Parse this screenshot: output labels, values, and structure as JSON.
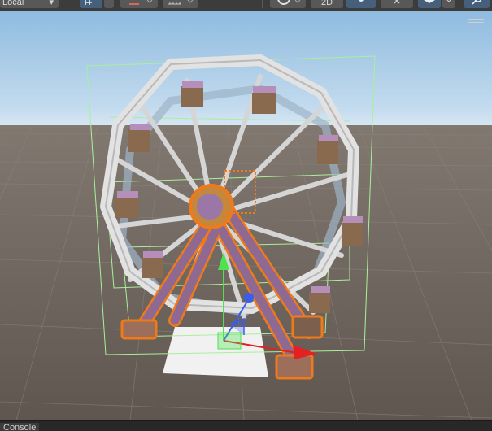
{
  "toolbar": {
    "pivot_rotation_label": "Local",
    "mode_2d_label": "2D",
    "items": [
      {
        "name": "pivot-rotation-dropdown",
        "icon": "chevron-down-icon"
      },
      {
        "name": "grid-snapping-button",
        "icon": "grid-snap-icon"
      },
      {
        "name": "increment-snap-button",
        "icon": "increment-snap-icon"
      },
      {
        "name": "draw-mode-dropdown",
        "icon": "shaded-sphere-icon"
      },
      {
        "name": "lighting-toggle",
        "icon": "lightbulb-icon"
      },
      {
        "name": "audio-toggle",
        "icon": "speaker-mute-icon"
      },
      {
        "name": "effects-dropdown",
        "icon": "layers-icon"
      },
      {
        "name": "search-button",
        "icon": "search-icon"
      }
    ]
  },
  "scene": {
    "menu_icon": "hamburger-icon",
    "colors": {
      "sky_top": "#8fbbe0",
      "sky_horizon": "#d6e6f3",
      "ground": "#6b625a",
      "wheel_frame": "#e2e2e2",
      "support_legs": "#8e6a93",
      "selection_outline": "#f07a1a",
      "bounds_box": "#a9f09a",
      "gizmo_y": "#4ee34e",
      "gizmo_x": "#e42121",
      "gizmo_z": "#3a5cf0"
    }
  },
  "console": {
    "tab_label": "Console"
  }
}
